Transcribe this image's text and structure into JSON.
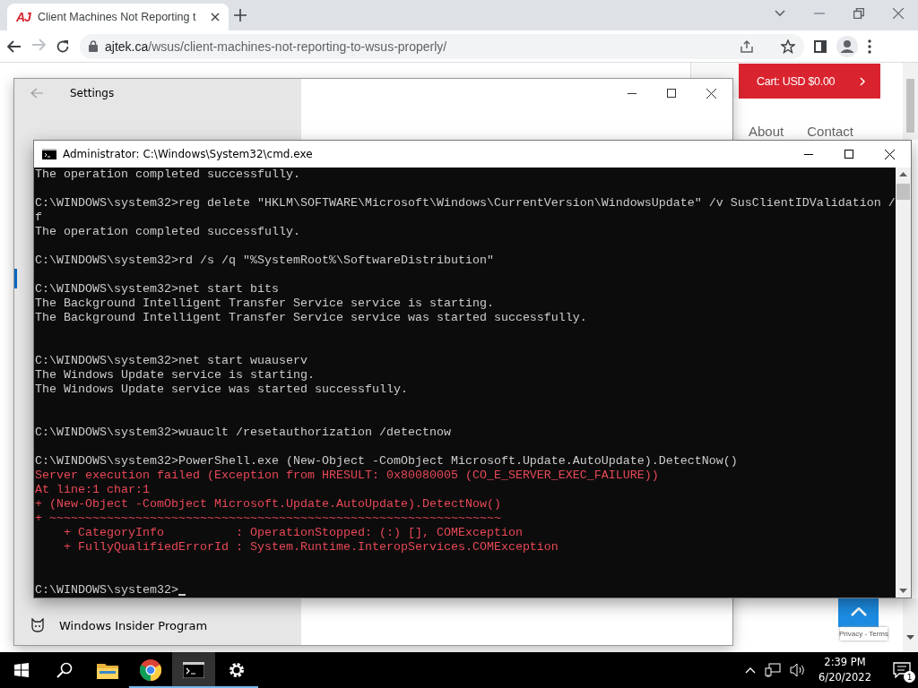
{
  "browser": {
    "tab": {
      "favicon_text": "AJ",
      "title": "Client Machines Not Reporting t",
      "selected": true
    },
    "forward_disabled": true,
    "url": {
      "host": "ajtek.ca",
      "path": "/wsus/client-machines-not-reporting-to-wsus-properly/"
    }
  },
  "page": {
    "cart": "Cart: USD $0.00",
    "nav": [
      "About",
      "Contact"
    ],
    "recaptcha": "Privacy - Terms"
  },
  "settings": {
    "title": "Settings",
    "nav_item": "Windows Insider Program"
  },
  "cmd": {
    "title": "Administrator: C:\\Windows\\System32\\cmd.exe",
    "lines": [
      {
        "kind": "output",
        "text": "The operation completed successfully."
      },
      {
        "kind": "blank"
      },
      {
        "kind": "output",
        "text": "C:\\WINDOWS\\system32>reg delete \"HKLM\\SOFTWARE\\Microsoft\\Windows\\CurrentVersion\\WindowsUpdate\" /v SusClientIDValidation /"
      },
      {
        "kind": "output",
        "text": "f"
      },
      {
        "kind": "output",
        "text": "The operation completed successfully."
      },
      {
        "kind": "blank"
      },
      {
        "kind": "output",
        "text": "C:\\WINDOWS\\system32>rd /s /q \"%SystemRoot%\\SoftwareDistribution\""
      },
      {
        "kind": "blank"
      },
      {
        "kind": "output",
        "text": "C:\\WINDOWS\\system32>net start bits"
      },
      {
        "kind": "output",
        "text": "The Background Intelligent Transfer Service service is starting."
      },
      {
        "kind": "output",
        "text": "The Background Intelligent Transfer Service service was started successfully."
      },
      {
        "kind": "blank"
      },
      {
        "kind": "blank"
      },
      {
        "kind": "output",
        "text": "C:\\WINDOWS\\system32>net start wuauserv"
      },
      {
        "kind": "output",
        "text": "The Windows Update service is starting."
      },
      {
        "kind": "output",
        "text": "The Windows Update service was started successfully."
      },
      {
        "kind": "blank"
      },
      {
        "kind": "blank"
      },
      {
        "kind": "output",
        "text": "C:\\WINDOWS\\system32>wuauclt /resetauthorization /detectnow"
      },
      {
        "kind": "blank"
      },
      {
        "kind": "output",
        "text": "C:\\WINDOWS\\system32>PowerShell.exe (New-Object -ComObject Microsoft.Update.AutoUpdate).DetectNow()"
      },
      {
        "kind": "error",
        "text": "Server execution failed (Exception from HRESULT: 0x80080005 (CO_E_SERVER_EXEC_FAILURE))"
      },
      {
        "kind": "error",
        "text": "At line:1 char:1"
      },
      {
        "kind": "error",
        "text": "+ (New-Object -ComObject Microsoft.Update.AutoUpdate).DetectNow()"
      },
      {
        "kind": "error",
        "text": "+ ~~~~~~~~~~~~~~~~~~~~~~~~~~~~~~~~~~~~~~~~~~~~~~~~~~~~~~~~~~~~~~~"
      },
      {
        "kind": "error",
        "text": "    + CategoryInfo          : OperationStopped: (:) [], COMException"
      },
      {
        "kind": "error",
        "text": "    + FullyQualifiedErrorId : System.Runtime.InteropServices.COMException"
      },
      {
        "kind": "blank"
      },
      {
        "kind": "blank"
      },
      {
        "kind": "prompt",
        "text": "C:\\WINDOWS\\system32>",
        "cursor": true
      }
    ]
  },
  "taskbar": {
    "apps": [
      {
        "kind": "start",
        "running": false,
        "selected": false
      },
      {
        "kind": "search",
        "running": false,
        "selected": false
      },
      {
        "kind": "explorer",
        "running": false,
        "selected": false
      },
      {
        "kind": "chrome",
        "running": true,
        "selected": false
      },
      {
        "kind": "terminal",
        "running": true,
        "selected": true
      },
      {
        "kind": "settings",
        "running": true,
        "selected": false
      }
    ],
    "time": "2:39 PM",
    "date": "6/20/2022",
    "notifications": "1"
  }
}
